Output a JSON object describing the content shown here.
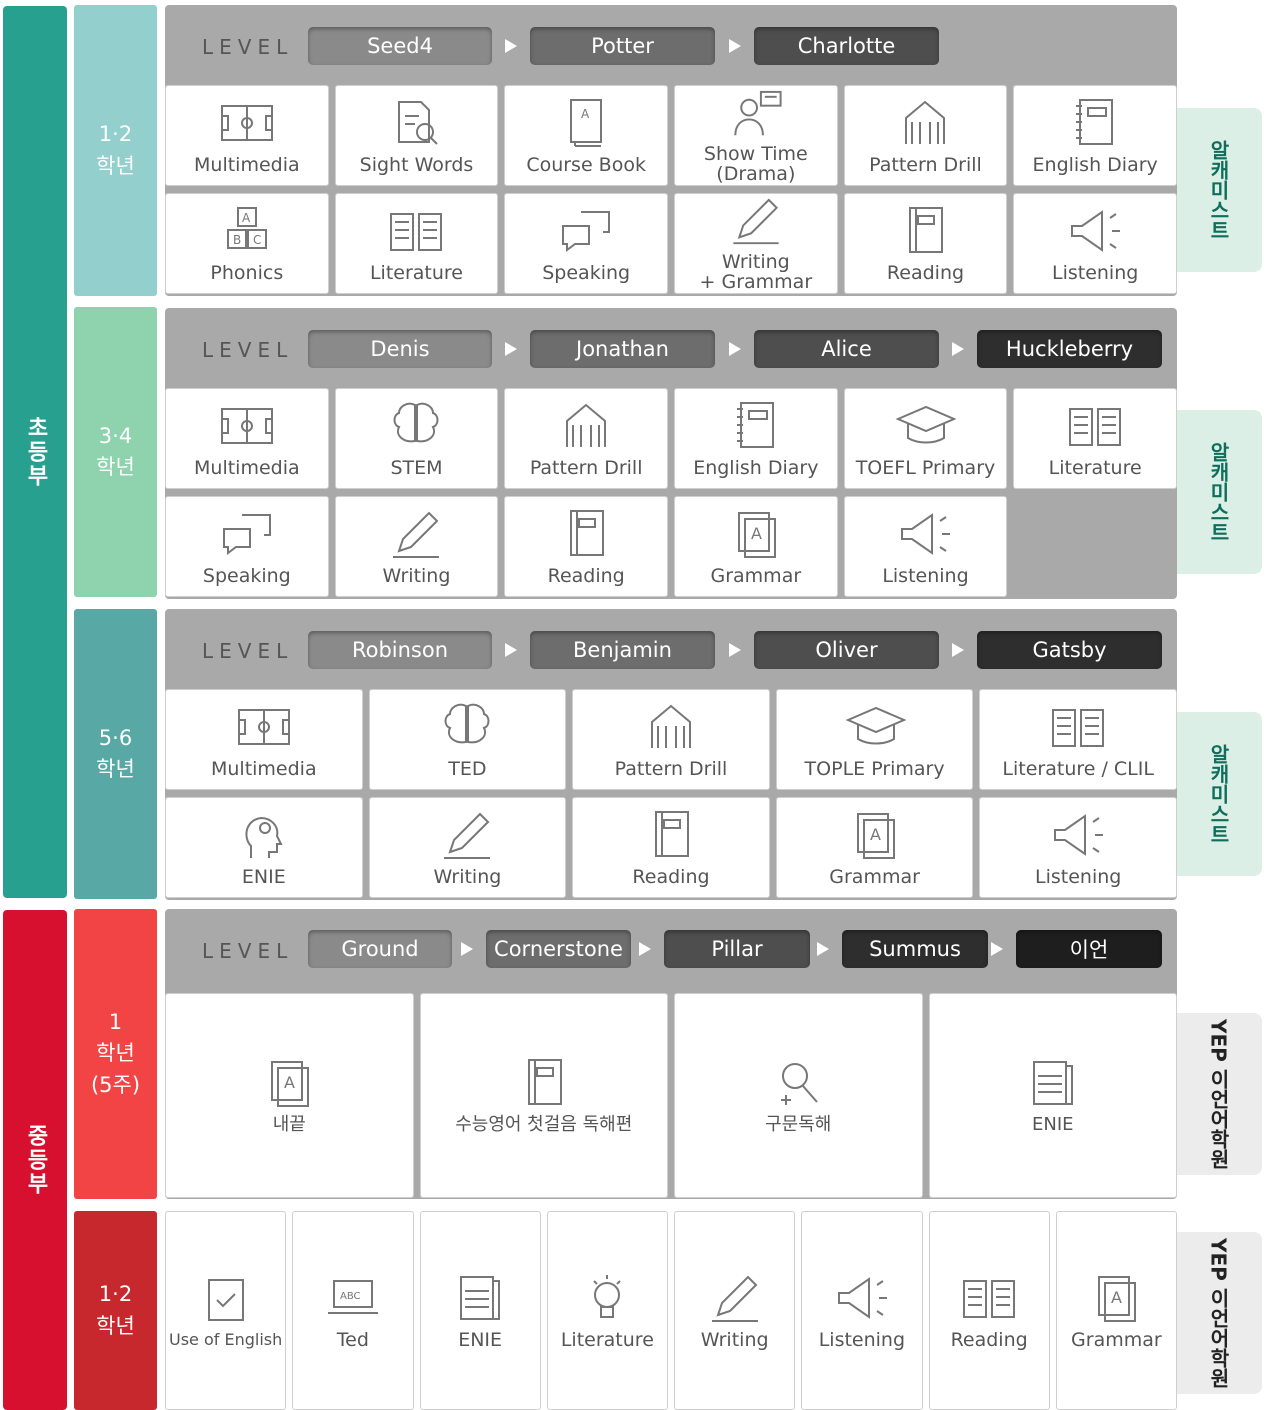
{
  "divisions": [
    {
      "label": "초등부",
      "color": "#27a08f"
    },
    {
      "label": "중등부",
      "color": "#d7102f"
    }
  ],
  "grades": [
    {
      "label": "1·2\n학년",
      "color": "#92cfcd"
    },
    {
      "label": "3·4\n학년",
      "color": "#8ed2ae"
    },
    {
      "label": "5·6\n학년",
      "color": "#58a8a5"
    },
    {
      "label": "1\n학년\n(5주)",
      "color": "#f24444"
    },
    {
      "label": "1·2\n학년",
      "color": "#c6282d"
    }
  ],
  "level_label": "LEVEL",
  "pill_colors": [
    "#8a8a8a",
    "#6d6d6d",
    "#4e4e4e",
    "#2e2e2e",
    "#1e1e1e"
  ],
  "sections": [
    {
      "levels": [
        "Seed4",
        "Potter",
        "Charlotte"
      ],
      "rows": [
        [
          {
            "label": "Multimedia",
            "icon": "field-icon"
          },
          {
            "label": "Sight Words",
            "icon": "doc-search-icon"
          },
          {
            "label": "Course Book",
            "icon": "book-icon"
          },
          {
            "label": "Show Time\n(Drama)",
            "icon": "drama-icon"
          },
          {
            "label": "Pattern Drill",
            "icon": "building-icon"
          },
          {
            "label": "English Diary",
            "icon": "diary-icon"
          }
        ],
        [
          {
            "label": "Phonics",
            "icon": "abc-blocks-icon"
          },
          {
            "label": "Literature",
            "icon": "open-book-icon"
          },
          {
            "label": "Speaking",
            "icon": "speech-icon"
          },
          {
            "label": "Writing\n+ Grammar",
            "icon": "pencil-icon"
          },
          {
            "label": "Reading",
            "icon": "reading-icon"
          },
          {
            "label": "Listening",
            "icon": "megaphone-icon"
          }
        ]
      ]
    },
    {
      "levels": [
        "Denis",
        "Jonathan",
        "Alice",
        "Huckleberry"
      ],
      "rows": [
        [
          {
            "label": "Multimedia",
            "icon": "field-icon"
          },
          {
            "label": "STEM",
            "icon": "brain-icon"
          },
          {
            "label": "Pattern Drill",
            "icon": "building-icon"
          },
          {
            "label": "English Diary",
            "icon": "diary-icon"
          },
          {
            "label": "TOEFL Primary",
            "icon": "graduation-cap-icon"
          },
          {
            "label": "Literature",
            "icon": "open-book-icon"
          }
        ],
        [
          {
            "label": "Speaking",
            "icon": "speech-icon"
          },
          {
            "label": "Writing",
            "icon": "pencil-icon"
          },
          {
            "label": "Reading",
            "icon": "reading-icon"
          },
          {
            "label": "Grammar",
            "icon": "grammar-icon"
          },
          {
            "label": "Listening",
            "icon": "megaphone-icon"
          }
        ]
      ]
    },
    {
      "levels": [
        "Robinson",
        "Benjamin",
        "Oliver",
        "Gatsby"
      ],
      "rows": [
        [
          {
            "label": "Multimedia",
            "icon": "field-icon"
          },
          {
            "label": "TED",
            "icon": "brain-icon"
          },
          {
            "label": "Pattern Drill",
            "icon": "building-icon"
          },
          {
            "label": "TOPLE Primary",
            "icon": "graduation-cap-icon"
          },
          {
            "label": "Literature / CLIL",
            "icon": "open-book-icon"
          }
        ],
        [
          {
            "label": "ENIE",
            "icon": "idea-head-icon"
          },
          {
            "label": "Writing",
            "icon": "pencil-icon"
          },
          {
            "label": "Reading",
            "icon": "reading-icon"
          },
          {
            "label": "Grammar",
            "icon": "grammar-icon"
          },
          {
            "label": "Listening",
            "icon": "megaphone-icon"
          }
        ]
      ]
    },
    {
      "levels": [
        "Ground",
        "Cornerstone",
        "Pillar",
        "Summus",
        "이언"
      ],
      "rows": [
        [
          {
            "label": "내끝",
            "icon": "grammar-icon"
          },
          {
            "label": "수능영어 첫걸음 독해편",
            "icon": "reading-icon"
          },
          {
            "label": "구문독해",
            "icon": "magnifier-icon"
          },
          {
            "label": "ENIE",
            "icon": "news-icon"
          }
        ]
      ]
    },
    {
      "levels": [],
      "rows": [
        [
          {
            "label": "Use of English",
            "icon": "checklist-icon"
          },
          {
            "label": "Ted",
            "icon": "laptop-icon"
          },
          {
            "label": "ENIE",
            "icon": "news-icon"
          },
          {
            "label": "Literature",
            "icon": "lightbulb-icon"
          },
          {
            "label": "Writing",
            "icon": "pencil-icon"
          },
          {
            "label": "Listening",
            "icon": "megaphone-icon"
          },
          {
            "label": "Reading",
            "icon": "open-book-icon"
          },
          {
            "label": "Grammar",
            "icon": "grammar-icon"
          }
        ]
      ]
    }
  ],
  "side_tabs": [
    {
      "label": "알캐미스트",
      "bg": "#dcefe6",
      "color": "#0f6e5b"
    },
    {
      "label": "알캐미스트",
      "bg": "#dcefe6",
      "color": "#0f6e5b"
    },
    {
      "label": "알캐미스트",
      "bg": "#dcefe6",
      "color": "#0f6e5b"
    },
    {
      "label": "YEP 이언어학원",
      "bg": "#ececec",
      "color": "#222"
    },
    {
      "label": "YEP 이언어학원",
      "bg": "#ececec",
      "color": "#222"
    }
  ]
}
